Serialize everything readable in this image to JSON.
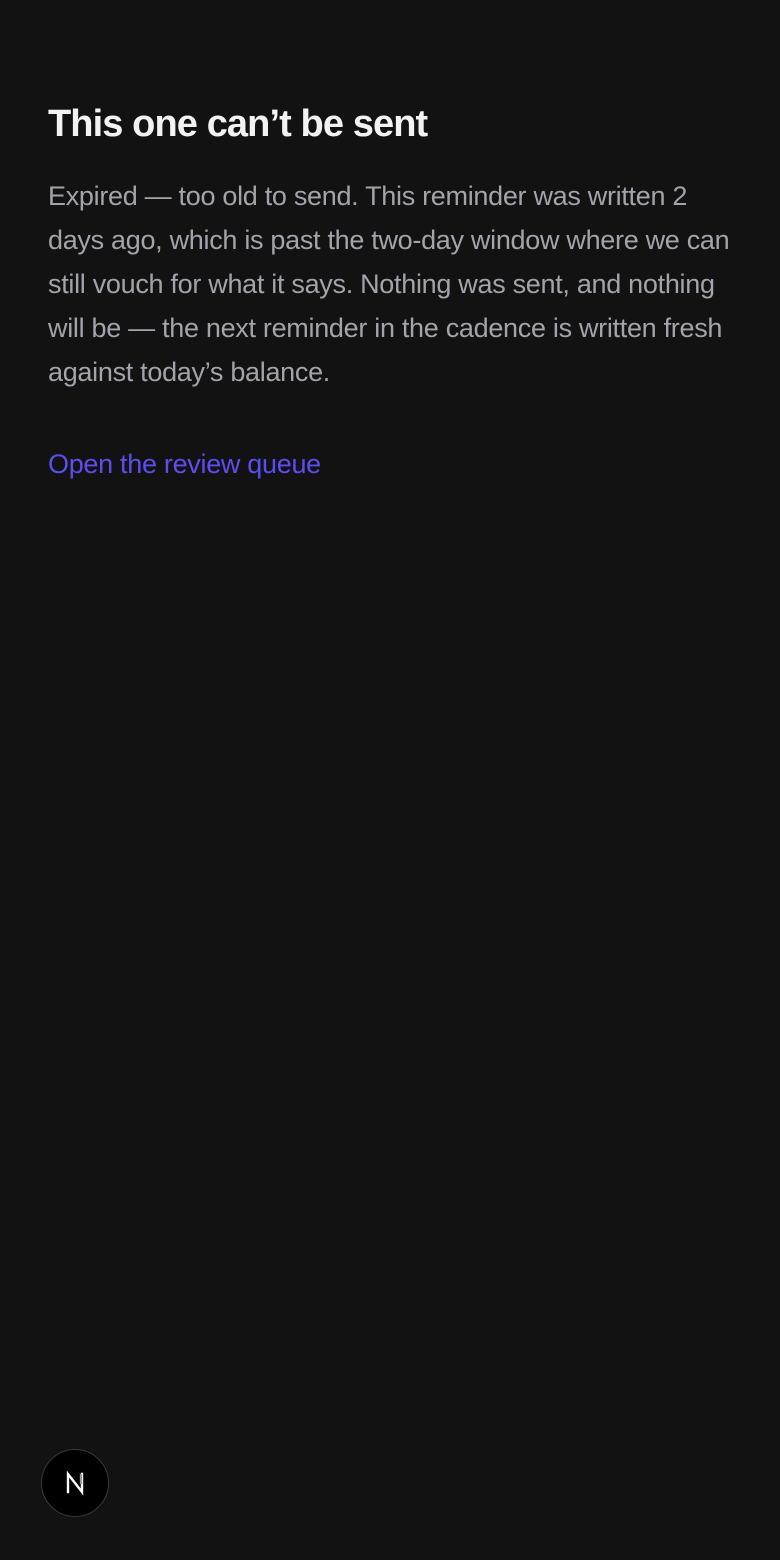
{
  "page": {
    "title": "This one can’t be sent",
    "message": "Expired — too old to send. This reminder was written 2 days ago, which is past the two-day window where we can still vouch for what it says. Nothing was sent, and nothing will be — the next reminder in the cadence is written fresh against today’s balance.",
    "link_label": "Open the review queue"
  },
  "dev_badge": {
    "icon": "nextjs-logo-icon"
  },
  "colors": {
    "background": "#121212",
    "title": "#f2f2f2",
    "body_text": "#a3a3ac",
    "link": "#5b4ef0"
  }
}
